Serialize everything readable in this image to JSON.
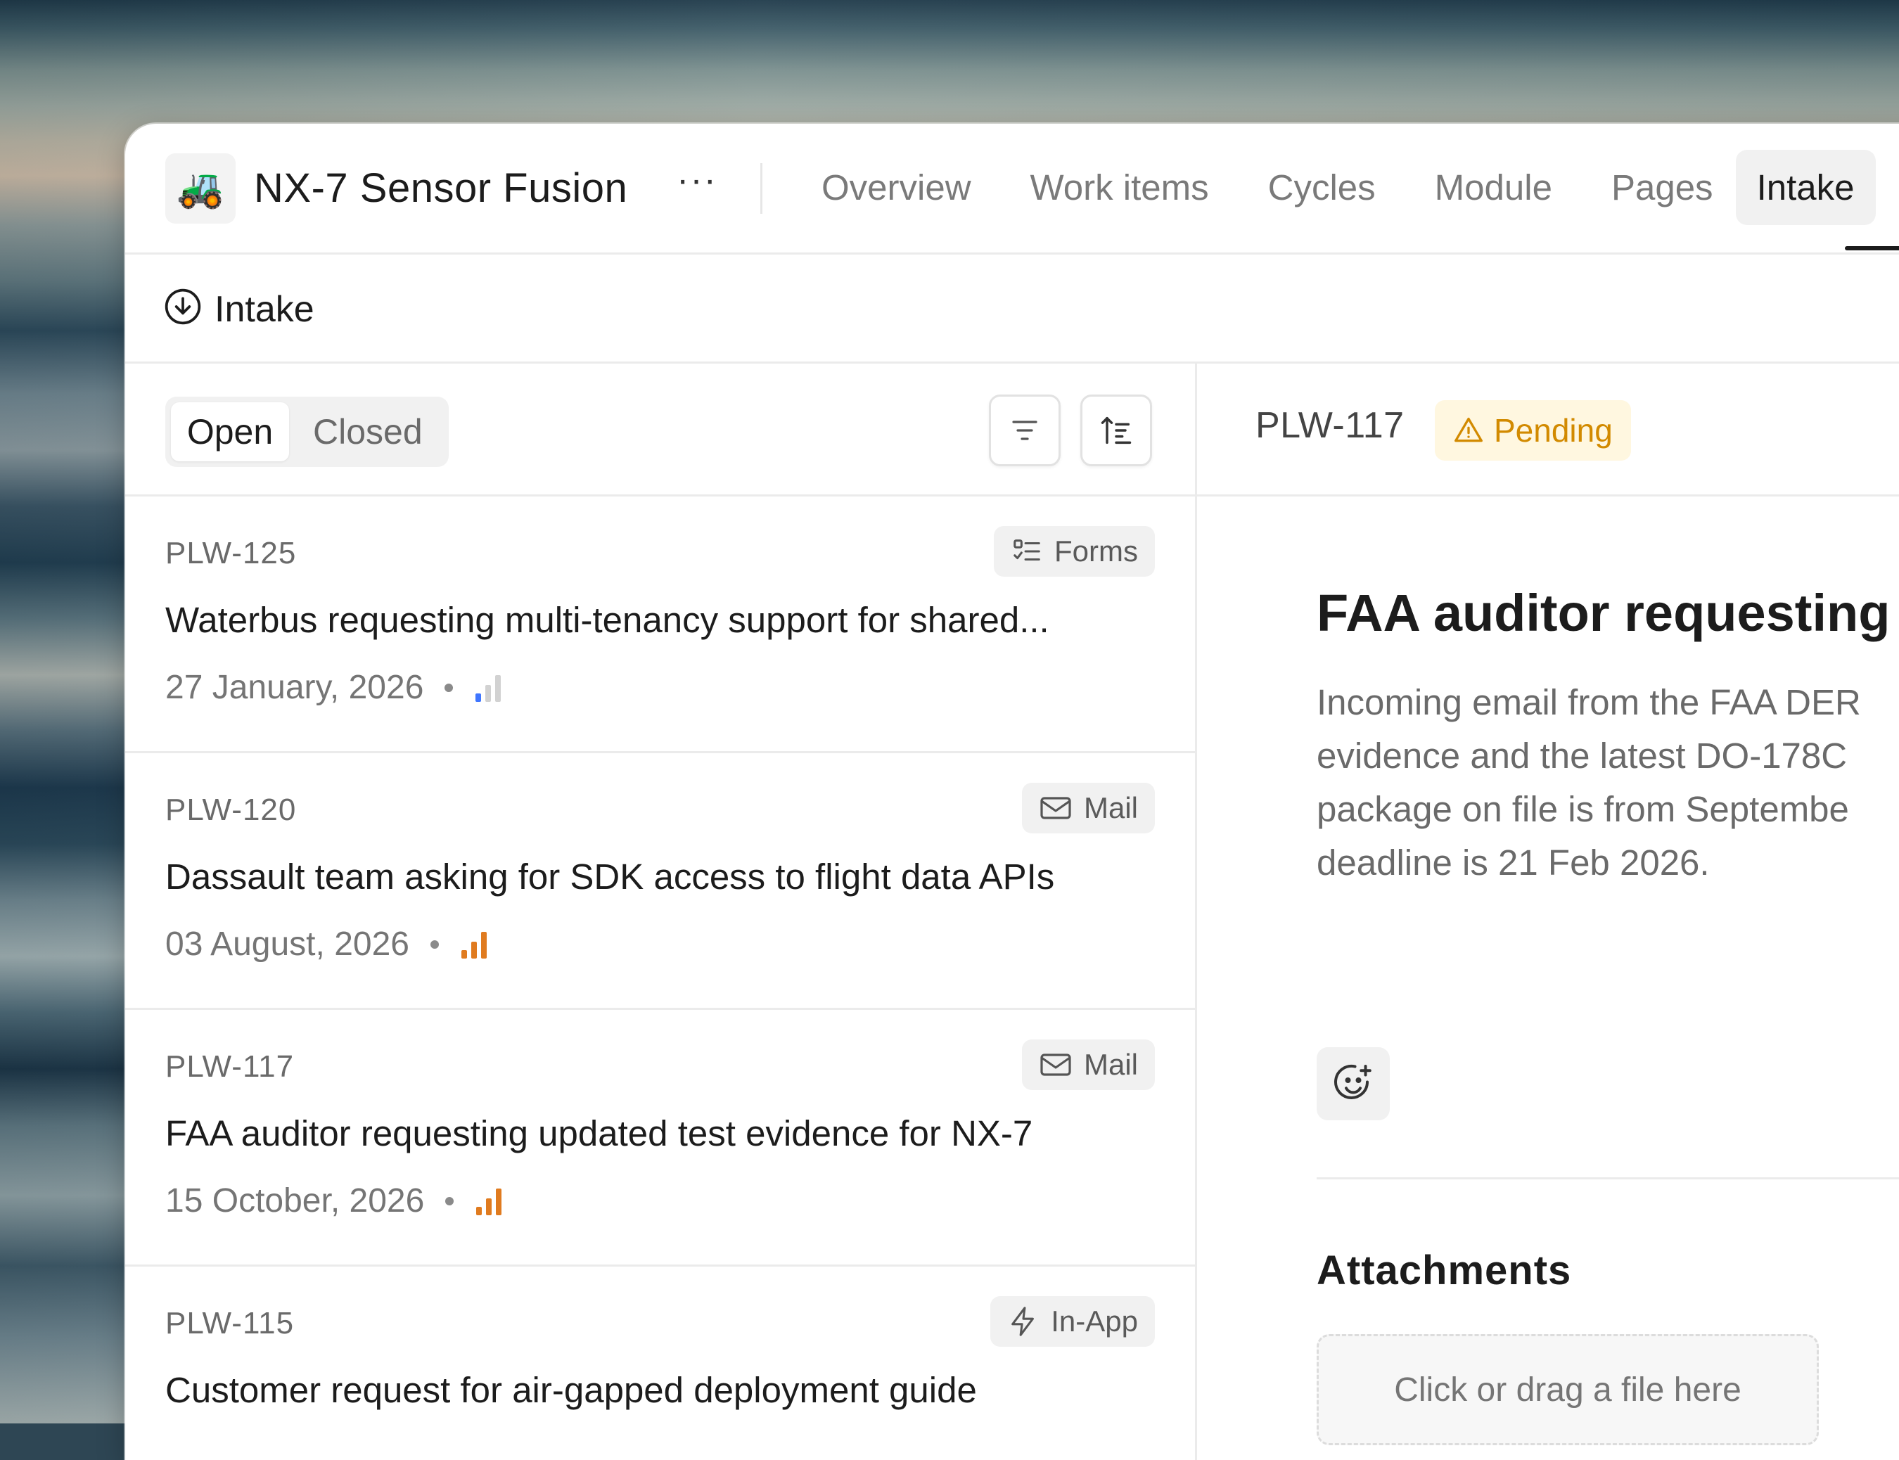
{
  "project": {
    "icon": "🚜",
    "title": "NX-7 Sensor Fusion",
    "more": "···"
  },
  "tabs": [
    {
      "label": "Overview"
    },
    {
      "label": "Work items"
    },
    {
      "label": "Cycles"
    },
    {
      "label": "Module"
    },
    {
      "label": "Pages"
    },
    {
      "label": "Intake",
      "active": true
    }
  ],
  "section": {
    "label": "Intake"
  },
  "filter": {
    "open_label": "Open",
    "closed_label": "Closed"
  },
  "items": [
    {
      "id": "PLW-125",
      "title": "Waterbus requesting multi-tenancy support for shared...",
      "date": "27 January, 2026",
      "source": "Forms",
      "source_icon": "forms-icon",
      "priority": "low",
      "priority_color": "#3f76ff"
    },
    {
      "id": "PLW-120",
      "title": "Dassault team asking for SDK access to flight data APIs",
      "date": "03 August, 2026",
      "source": "Mail",
      "source_icon": "mail-icon",
      "priority": "high",
      "priority_color": "#e07b1f"
    },
    {
      "id": "PLW-117",
      "title": "FAA auditor requesting updated test evidence for NX-7",
      "date": "15 October, 2026",
      "source": "Mail",
      "source_icon": "mail-icon",
      "priority": "high",
      "priority_color": "#e07b1f"
    },
    {
      "id": "PLW-115",
      "title": "Customer request for air-gapped deployment guide",
      "date": "",
      "source": "In-App",
      "source_icon": "lightning-icon",
      "priority": "",
      "priority_color": ""
    }
  ],
  "detail": {
    "id": "PLW-117",
    "status": "Pending",
    "status_color": "#d28a00",
    "title": "FAA auditor requesting",
    "description_lines": [
      "Incoming email from the FAA DER",
      "evidence and the latest DO-178C",
      "package on file is from Septembe",
      "deadline is 21 Feb 2026."
    ],
    "attachments_heading": "Attachments",
    "dropzone_text": "Click or drag a file here"
  }
}
